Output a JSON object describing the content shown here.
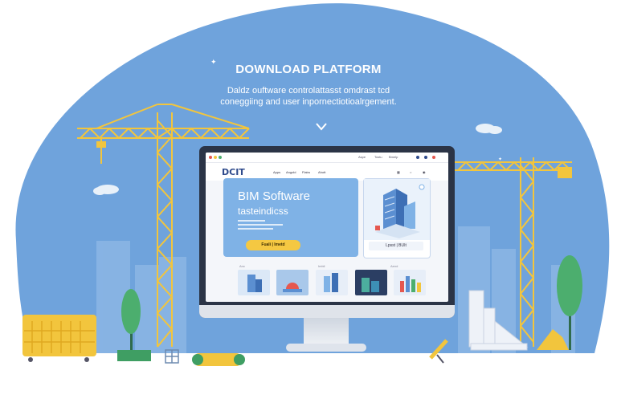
{
  "hero": {
    "title": "DOWNLOAD PLATFORM",
    "subtitle_line1": "Daldz ouftware controlattasst omdrast tcd",
    "subtitle_line2": "coneggiing and user inpornectiotioalrgement."
  },
  "screen": {
    "topbar_links": [
      "Aspe",
      "Tostu",
      "Bmelp"
    ],
    "logo": "DCIT",
    "nav_links": [
      "Apps",
      "Angold",
      "Flatru",
      "Ahott"
    ],
    "hero_card": {
      "title": "BIM Software",
      "subtitle": "tasteindicss",
      "cta_label": "Fuali | Imetd"
    },
    "side_card": {
      "badge": "Lpsst | BUIt"
    },
    "section_labels": [
      "Anc",
      "Imbil",
      "Aend"
    ]
  },
  "colors": {
    "sky": "#6fa3dc",
    "crane": "#f2c53d",
    "screen_card": "#7fb2e6",
    "cta": "#f5c842",
    "tree": "#4cae6e"
  }
}
